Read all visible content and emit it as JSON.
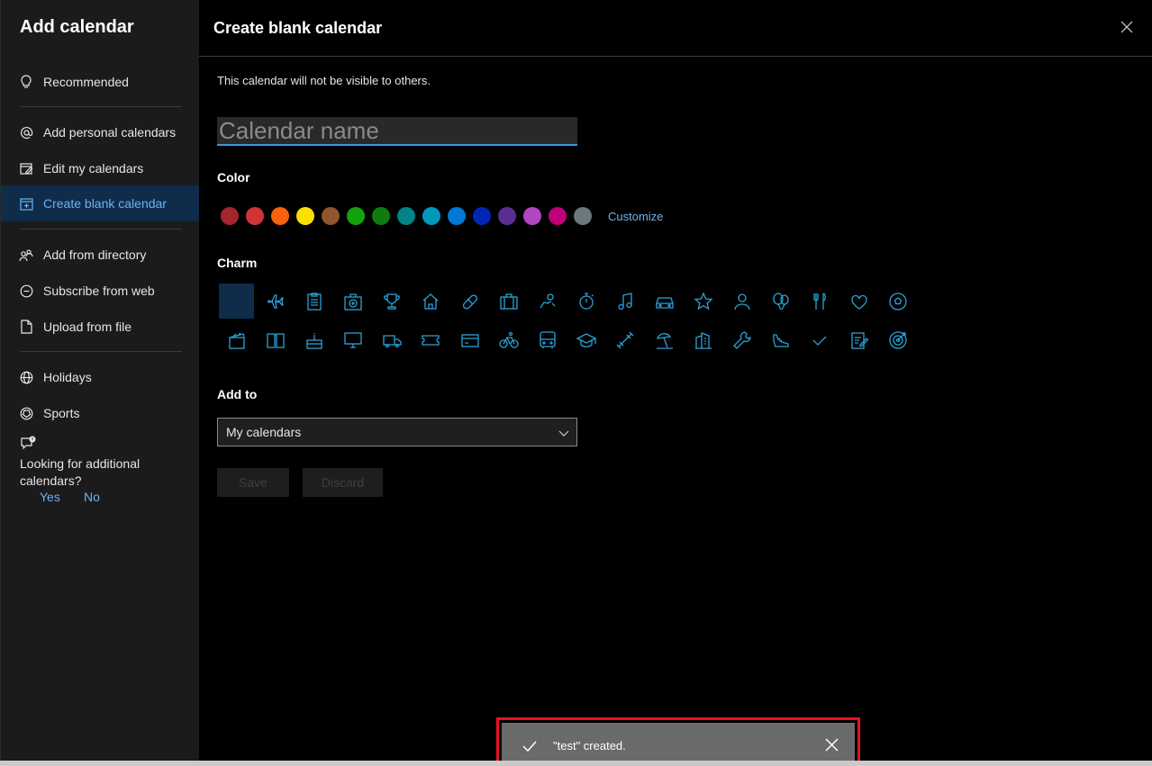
{
  "sidebar": {
    "title": "Add calendar",
    "items": [
      {
        "label": "Recommended",
        "icon": "lightbulb-icon"
      },
      {
        "label": "Add personal calendars",
        "icon": "at-icon"
      },
      {
        "label": "Edit my calendars",
        "icon": "edit-calendar-icon"
      },
      {
        "label": "Create blank calendar",
        "icon": "calendar-add-icon",
        "active": true
      },
      {
        "label": "Add from directory",
        "icon": "people-icon"
      },
      {
        "label": "Subscribe from web",
        "icon": "link-icon"
      },
      {
        "label": "Upload from file",
        "icon": "file-icon"
      },
      {
        "label": "Holidays",
        "icon": "globe-icon"
      },
      {
        "label": "Sports",
        "icon": "ball-icon"
      }
    ],
    "feedback": {
      "question": "Looking for additional calendars?",
      "yes": "Yes",
      "no": "No"
    }
  },
  "main": {
    "title": "Create blank calendar",
    "note": "This calendar will not be visible to others.",
    "name_placeholder": "Calendar name",
    "color_label": "Color",
    "colors": [
      "#a4262c",
      "#d13438",
      "#f7630c",
      "#fce100",
      "#8e562e",
      "#13a10e",
      "#107c10",
      "#038387",
      "#0099bc",
      "#0078d4",
      "#0027b4",
      "#5c2e91",
      "#b146c2",
      "#bf0077",
      "#69797e"
    ],
    "customize": "Customize",
    "charm_label": "Charm",
    "add_to_label": "Add to",
    "add_to_value": "My calendars",
    "save": "Save",
    "discard": "Discard"
  },
  "toast": {
    "message": "\"test\" created."
  }
}
